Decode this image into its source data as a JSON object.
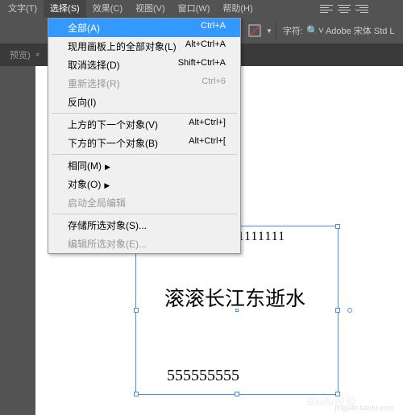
{
  "menubar": {
    "items": [
      "文字(T)",
      "选择(S)",
      "效果(C)",
      "视图(V)",
      "窗口(W)",
      "帮助(H)"
    ]
  },
  "toolbar": {
    "char_label": "字符:",
    "font_name": "Adobe 宋体 Std L"
  },
  "tab": {
    "name": "预览)",
    "close": "×"
  },
  "dropdown": {
    "items": [
      {
        "label": "全部(A)",
        "shortcut": "Ctrl+A",
        "highlight": true
      },
      {
        "label": "现用画板上的全部对象(L)",
        "shortcut": "Alt+Ctrl+A"
      },
      {
        "label": "取消选择(D)",
        "shortcut": "Shift+Ctrl+A"
      },
      {
        "label": "重新选择(R)",
        "shortcut": "Ctrl+6",
        "disabled": true
      },
      {
        "label": "反向(I)"
      },
      {
        "sep": true
      },
      {
        "label": "上方的下一个对象(V)",
        "shortcut": "Alt+Ctrl+]"
      },
      {
        "label": "下方的下一个对象(B)",
        "shortcut": "Alt+Ctrl+["
      },
      {
        "sep": true
      },
      {
        "label": "相同(M)",
        "submenu": true
      },
      {
        "label": "对象(O)",
        "submenu": true
      },
      {
        "label": "启动全局编辑",
        "disabled": true
      },
      {
        "sep": true
      },
      {
        "label": "存储所选对象(S)..."
      },
      {
        "label": "编辑所选对象(E)...",
        "disabled": true
      }
    ]
  },
  "artwork": {
    "line1": "111111111111111111111",
    "line2": "滚滚长江东逝水",
    "line3": "555555555"
  },
  "watermark": {
    "text": "Baidu经验",
    "url": "jingyan.baidu.com"
  }
}
